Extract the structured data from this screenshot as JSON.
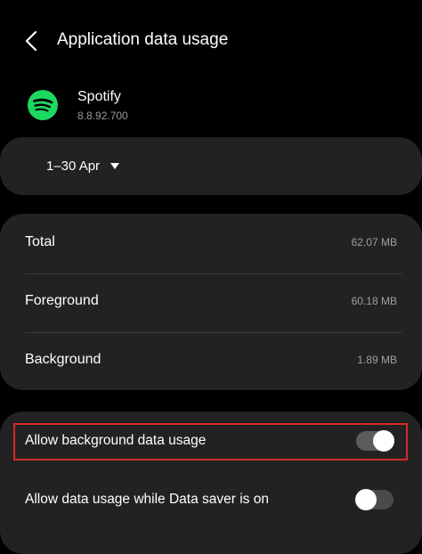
{
  "header": {
    "back_icon": "chevron-left-icon",
    "title": "Application data usage"
  },
  "app": {
    "icon": "spotify-logo-icon",
    "icon_color": "#1ed760",
    "name": "Spotify",
    "version": "8.8.92.700"
  },
  "date_range": {
    "label": "1–30 Apr",
    "icon": "caret-down-icon"
  },
  "usage": {
    "rows": [
      {
        "label": "Total",
        "value": "62.07 MB"
      },
      {
        "label": "Foreground",
        "value": "60.18 MB"
      },
      {
        "label": "Background",
        "value": "1.89 MB"
      }
    ]
  },
  "toggles": [
    {
      "label": "Allow background data usage",
      "enabled": true
    },
    {
      "label": "Allow data usage while Data saver is on",
      "enabled": false
    }
  ],
  "colors": {
    "background": "#000000",
    "card": "#222222",
    "highlight": "#d42a2a",
    "switch_on_track": "#5c5c5c",
    "switch_off_track": "#4a4a4a"
  }
}
